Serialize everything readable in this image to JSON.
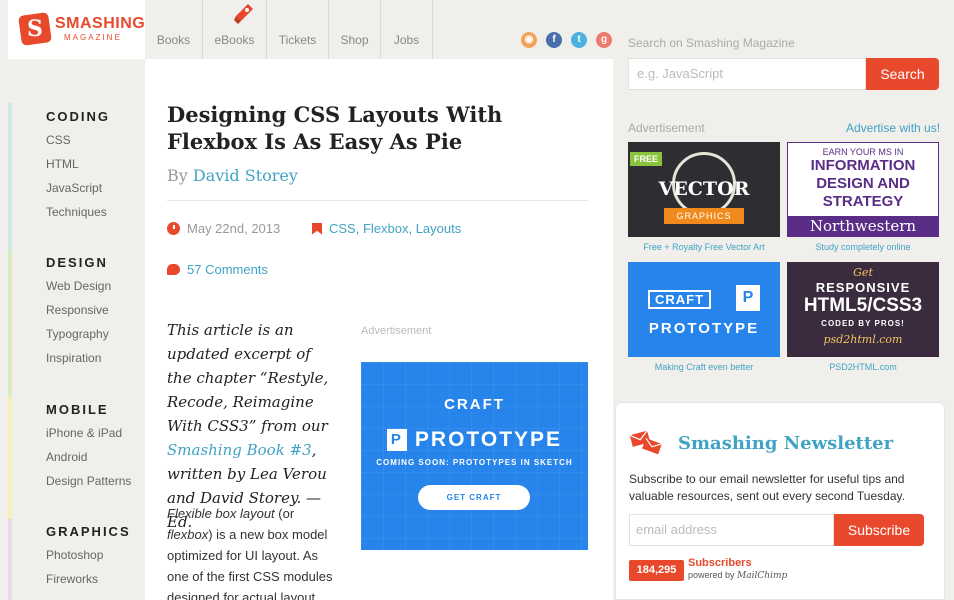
{
  "header": {
    "logo_name": "SMASHING",
    "logo_sub": "MAGAZINE",
    "logo_letter": "S",
    "nav": [
      "Books",
      "eBooks",
      "Tickets",
      "Shop",
      "Jobs"
    ]
  },
  "social": {
    "rss_glyph": "◉",
    "facebook_glyph": "f",
    "twitter_glyph": "t",
    "googleplus_glyph": "g"
  },
  "sidebar": {
    "groups": [
      {
        "title": "CODING",
        "items": [
          "CSS",
          "HTML",
          "JavaScript",
          "Techniques"
        ]
      },
      {
        "title": "DESIGN",
        "items": [
          "Web Design",
          "Responsive",
          "Typography",
          "Inspiration"
        ]
      },
      {
        "title": "MOBILE",
        "items": [
          "iPhone & iPad",
          "Android",
          "Design Patterns"
        ]
      },
      {
        "title": "GRAPHICS",
        "items": [
          "Photoshop",
          "Fireworks"
        ]
      }
    ]
  },
  "article": {
    "title": "Designing CSS Layouts With Flexbox Is As Easy As Pie",
    "by": "By",
    "author": "David Storey",
    "date": "May 22nd, 2013",
    "tags": "CSS, Flexbox, Layouts",
    "comments": "57 Comments",
    "intro_1": "This article is an updated excerpt of the chapter “Restyle, Recode, Reimagine With CSS3” from our",
    "intro_link": "Smashing Book #3",
    "intro_2": ", written by Lea Verou and David Storey. — Ed.",
    "body_em1": "Flexible box layout",
    "body_1": " (or ",
    "body_em2": "flexbox",
    "body_2": ") is a new box model optimized for UI layout. As one of the first CSS modules designed for actual layout"
  },
  "inline_ad": {
    "label": "Advertisement",
    "brand": "CRAFT",
    "product_letter": "P",
    "product": "PROTOTYPE",
    "tagline": "COMING SOON: PROTOTYPES IN SKETCH",
    "cta": "GET CRAFT"
  },
  "search": {
    "label": "Search on Smashing Magazine",
    "placeholder": "e.g. JavaScript",
    "button": "Search"
  },
  "ads": {
    "label": "Advertisement",
    "advertise_link": "Advertise with us!",
    "tiles": [
      {
        "free": "FREE",
        "main": "VECTOR",
        "ribbon": "GRAPHICS",
        "caption": "Free + Royalty Free Vector Art"
      },
      {
        "line1": "EARN YOUR MS IN",
        "line2": "INFORMATION DESIGN AND STRATEGY",
        "line3": "Northwestern",
        "caption": "Study completely online"
      },
      {
        "line1": "CRAFT",
        "letter": "P",
        "line2": "PROTOTYPE",
        "caption": "Making Craft even better"
      },
      {
        "line1": "Get",
        "line2": "RESPONSIVE",
        "line3": "HTML5/CSS3",
        "line4": "CODED BY PROS!",
        "line5": "psd2html.com",
        "caption": "PSD2HTML.com"
      }
    ]
  },
  "newsletter": {
    "title": "Smashing Newsletter",
    "description": "Subscribe to our email newsletter for useful tips and valuable resources, sent out every second Tuesday.",
    "placeholder": "email address",
    "button": "Subscribe",
    "count": "184,295",
    "subscribers_label": "Subscribers",
    "powered_by": "powered by",
    "powered_brand": "MailChimp"
  },
  "colors": {
    "accent": "#e8492c",
    "link": "#41a3c4",
    "background": "#f0efec"
  }
}
